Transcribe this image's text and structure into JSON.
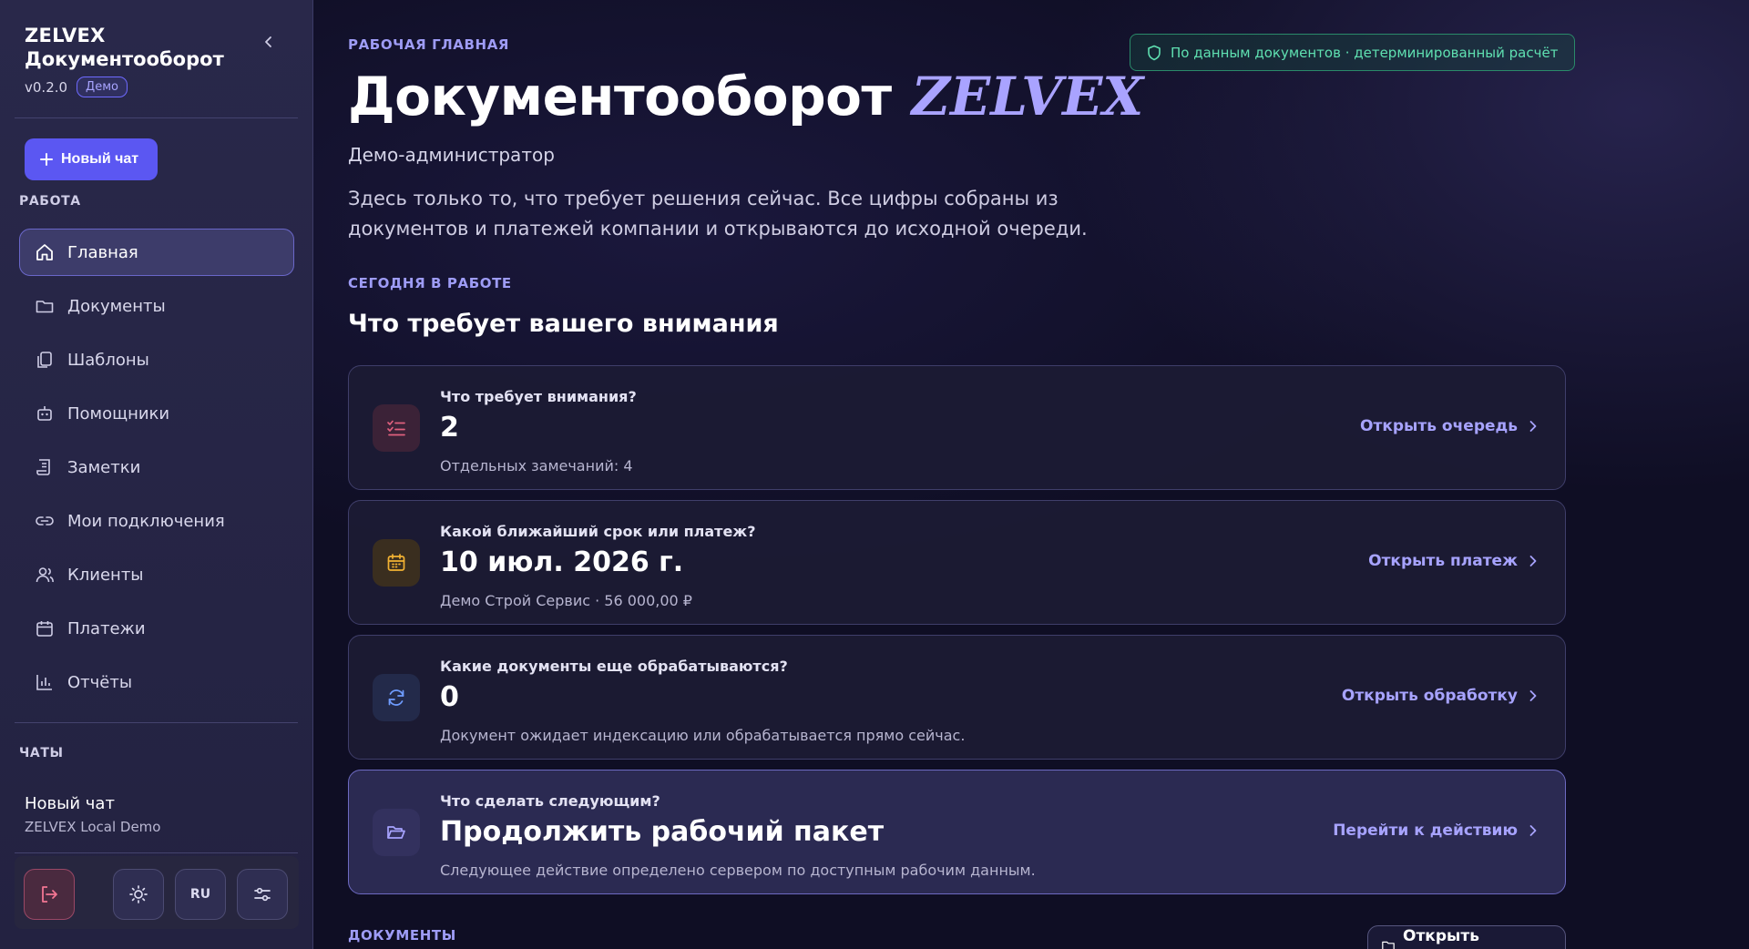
{
  "brand": {
    "line1": "ZELVEX",
    "line2": "Документооборот",
    "version": "v0.2.0",
    "badge": "Демо"
  },
  "sidebar": {
    "new_chat_label": "Новый чат",
    "work_section": "РАБОТА",
    "items": [
      {
        "label": "Главная",
        "icon": "home-icon",
        "active": true
      },
      {
        "label": "Документы",
        "icon": "folder-icon"
      },
      {
        "label": "Шаблоны",
        "icon": "copy-icon"
      },
      {
        "label": "Помощники",
        "icon": "bot-icon"
      },
      {
        "label": "Заметки",
        "icon": "scroll-icon"
      },
      {
        "label": "Мои подключения",
        "icon": "link-icon"
      },
      {
        "label": "Клиенты",
        "icon": "users-icon"
      },
      {
        "label": "Платежи",
        "icon": "calendar-icon"
      },
      {
        "label": "Отчёты",
        "icon": "bar-chart-icon"
      }
    ],
    "chats_section": "ЧАТЫ",
    "chat": {
      "title": "Новый чат",
      "subtitle": "ZELVEX Local Demo"
    },
    "toolbar": {
      "lang": "RU"
    }
  },
  "main": {
    "kicker": "РАБОЧАЯ ГЛАВНАЯ",
    "title": "Документооборот",
    "title_brand": "ZELVEX",
    "role": "Демо-администратор",
    "description": "Здесь только то, что требует решения сейчас. Все цифры собраны из документов и платежей компании и открываются до исходной очереди.",
    "status_pill": "По данным документов · детерминированный расчёт",
    "today_kicker": "СЕГОДНЯ В РАБОТЕ",
    "section_title": "Что требует вашего внимания",
    "cards": [
      {
        "question": "Что требует внимания?",
        "value": "2",
        "sub": "Отдельных замечаний: 4",
        "action": "Открыть очередь",
        "icon": "list-check-icon",
        "accent": "#e0607e"
      },
      {
        "question": "Какой ближайший срок или платеж?",
        "value": "10 июл. 2026 г.",
        "sub": "Демо Строй Сервис · 56 000,00 ₽",
        "action": "Открыть платеж",
        "icon": "calendar-icon",
        "accent": "#f2b233"
      },
      {
        "question": "Какие документы еще обрабатываются?",
        "value": "0",
        "sub": "Документ ожидает индексацию или обрабатывается прямо сейчас.",
        "action": "Открыть обработку",
        "icon": "refresh-icon",
        "accent": "#6f9cff"
      },
      {
        "question": "Что сделать следующим?",
        "value": "Продолжить рабочий пакет",
        "sub": "Следующее действие определено сервером по доступным рабочим данным.",
        "action": "Перейти к действию",
        "icon": "folder-open-icon",
        "accent": "#a7a3ff"
      }
    ],
    "docs_kicker": "ДОКУМЕНТЫ",
    "open_docs_label": "Открыть документы"
  },
  "colors": {
    "accent": "#5b57f2",
    "accent_text": "#a7a3ff",
    "success": "#5fe0b1",
    "danger": "#e0607e"
  }
}
